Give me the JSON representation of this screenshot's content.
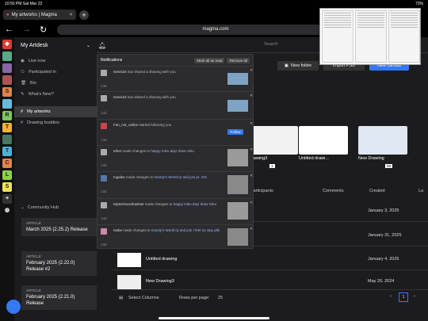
{
  "status": {
    "time": "10:50 PM",
    "date": "Sat Mar 22",
    "battery": "73%"
  },
  "tab": {
    "title": "My artworks | Magma",
    "new_tab": "+"
  },
  "browser": {
    "url": "magma.com"
  },
  "artdesk": {
    "title": "My Artdesk",
    "items": [
      {
        "label": "Live now"
      },
      {
        "label": "Participated in"
      },
      {
        "label": "Bin"
      },
      {
        "label": "What's New?"
      },
      {
        "label": "My artworks"
      },
      {
        "label": "Drawing buddies"
      }
    ]
  },
  "sidebar_letters": [
    "S",
    "R",
    "T",
    "T",
    "C",
    "L",
    "S"
  ],
  "community": {
    "label": "Community Hub",
    "articles": [
      {
        "kind": "ARTICLE",
        "title": "March 2025 (2.25.2) Release"
      },
      {
        "kind": "ARTICLE",
        "title": "February 2025 (2.22.0) Release #2"
      },
      {
        "kind": "ARTICLE",
        "title": "February 2025 (2.21.0) Release"
      }
    ]
  },
  "toolbar": {
    "search_placeholder": "Search",
    "new_folder": "New folder",
    "import": "Import PSD",
    "new_canvas": "New canvas"
  },
  "cards": [
    {
      "name": "Drawing3",
      "badge": "1"
    },
    {
      "name": "Untitled drawi..."
    },
    {
      "name": "New Drawing",
      "badge": "59"
    }
  ],
  "table": {
    "headers": {
      "participants": "Participants",
      "comments": "Comments",
      "created": "Created",
      "last": "La"
    },
    "rows": [
      {
        "name": "",
        "date": "January 3, 2025"
      },
      {
        "name": "",
        "date": "January 31, 2025"
      },
      {
        "name": "Untitled drawing",
        "date": "January 4, 2025"
      },
      {
        "name": "New Drawing3",
        "date": "May 20, 2024"
      }
    ]
  },
  "footer": {
    "select_columns": "Select Columns",
    "rows_per_page": "Rows per page:",
    "rows_value": "25",
    "page": "1"
  },
  "notifications": {
    "title": "Notifications",
    "mark_all": "Mark all as read",
    "remove_all": "Remove all",
    "items": [
      {
        "user": "Isessi15",
        "action": "has shared a drawing with you",
        "target": "",
        "time": "13d",
        "kind": "thumb"
      },
      {
        "user": "Isessi15",
        "action": "has shared a drawing with you",
        "target": "",
        "time": "13d",
        "kind": "thumb"
      },
      {
        "user": "Fan_not_online",
        "action": "started following you",
        "target": "",
        "time": "13d",
        "kind": "follow",
        "button": "Follow"
      },
      {
        "user": "ether",
        "action": "made changes to",
        "target": "happy miku day! draw miku",
        "time": "13d",
        "kind": "thumb"
      },
      {
        "user": "Ingalee",
        "action": "made changes to",
        "target": "Dandy's World rp and join pt. 101",
        "time": "13d",
        "kind": "thumb"
      },
      {
        "user": "Mysteriousshadowt",
        "action": "made changes to",
        "target": "happy miku day! draw miku",
        "time": "13d",
        "kind": "thumb"
      },
      {
        "user": "Isabe",
        "action": "made changes to",
        "target": "Dandy's World rp and join I feel so stay phk",
        "time": "13d",
        "kind": "thumb"
      }
    ]
  }
}
